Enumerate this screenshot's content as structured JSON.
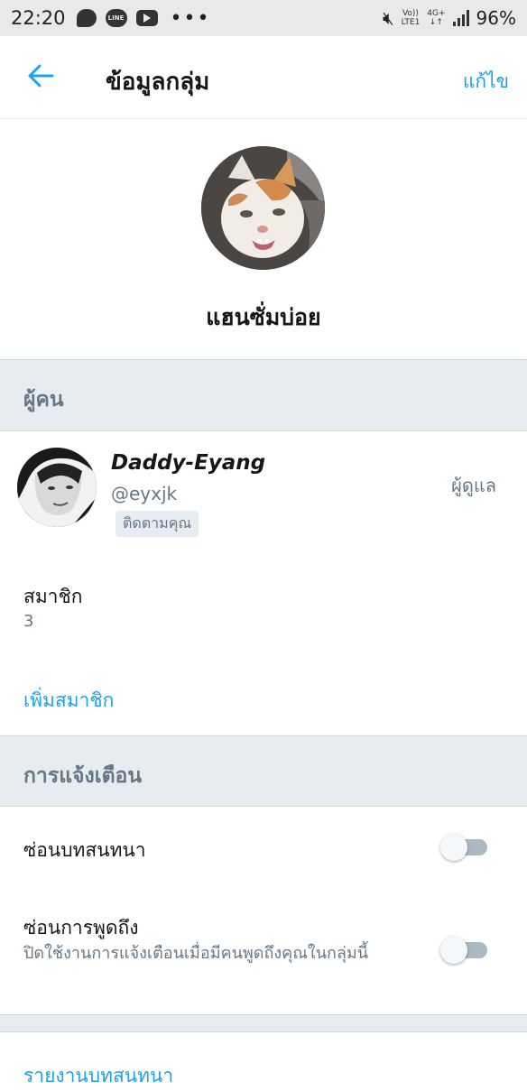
{
  "status_bar": {
    "time": "22:20",
    "icons": [
      "chat-bubble-icon",
      "line-app-icon",
      "youtube-icon",
      "more-dots-icon",
      "mute-icon",
      "volte-icon",
      "network-icon",
      "signal-icon"
    ],
    "line_text": "LINE",
    "volte": "Vo))",
    "lte": "LTE1",
    "network": "4G+",
    "battery": "96%"
  },
  "header": {
    "title": "ข้อมูลกลุ่ม",
    "edit_label": "แก้ไข"
  },
  "group": {
    "name": "แฮนซั่มบ่อย"
  },
  "people_section": {
    "title": "ผู้คน",
    "member": {
      "display_name": "Daddy-Eyang",
      "handle": "@eyxjk",
      "follows_you": "ติดตามคุณ",
      "role": "ผู้ดูแล"
    },
    "members_label": "สมาชิก",
    "members_count": "3",
    "add_member_label": "เพิ่มสมาชิก"
  },
  "notifications_section": {
    "title": "การแจ้งเตือน",
    "hide_conversation": {
      "label": "ซ่อนบทสนทนา",
      "enabled": false
    },
    "hide_mentions": {
      "label": "ซ่อนการพูดถึง",
      "description": "ปิดใช้งานการแจ้งเตือนเมื่อมีคนพูดถึงคุณในกลุ่มนี้",
      "enabled": false
    }
  },
  "report_label": "รายงานบทสนทนา",
  "colors": {
    "accent": "#1da1f2",
    "section_bg": "#e6ecf0",
    "secondary_text": "#657786"
  }
}
